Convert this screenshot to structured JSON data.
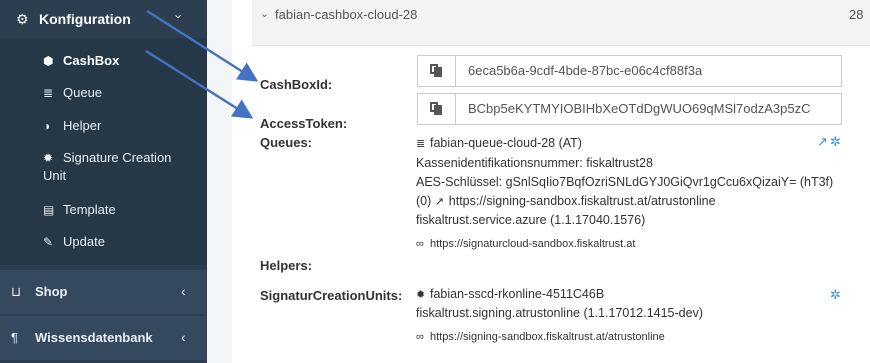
{
  "sidebar": {
    "config_label": "Konfiguration",
    "sub_items": [
      {
        "label": "CashBox",
        "icon": "cube-icon"
      },
      {
        "label": "Queue",
        "icon": "database-icon"
      },
      {
        "label": "Helper",
        "icon": "adjust-icon"
      },
      {
        "label": "Signature Creation",
        "icon": "certificate-icon"
      },
      {
        "label": "Unit",
        "icon": ""
      },
      {
        "label": "Template",
        "icon": "file-icon"
      },
      {
        "label": "Update",
        "icon": "wrench-icon"
      }
    ],
    "shop_label": "Shop",
    "wissen_label": "Wissensdatenbank"
  },
  "panel": {
    "title": "fabian-cashbox-cloud-28",
    "count": "28"
  },
  "fields": {
    "cashbox_label": "CashBoxId:",
    "cashbox_value": "6eca5b6a-9cdf-4bde-87bc-e06c4cf88f3a",
    "access_label": "AccessToken:",
    "access_value": "BCbp5eKYTMYIOBIHbXeOTdDgWUO69qMSl7odzA3p5zC"
  },
  "queues": {
    "label": "Queues:",
    "name": "fabian-queue-cloud-28 (AT)",
    "kassen": "Kassenidentifikationsnummer: fiskaltrust28",
    "aes": "AES-Schlüssel: gSnlSqIio7BqfOzriSNLdGYJ0GiQvr1gCcu6xQizaiY= (hT3f)",
    "endpoint": "https://signing-sandbox.fiskaltrust.at/atrustonline",
    "endpoint_prefix": "(0)",
    "service": "fiskaltrust.service.azure (1.1.17040.1576)",
    "link": "https://signaturcloud-sandbox.fiskaltrust.at"
  },
  "helpers": {
    "label": "Helpers:"
  },
  "scu": {
    "label": "SignaturCreationUnits:",
    "name": "fabian-sscd-rkonline-4511C46B",
    "package": "fiskaltrust.signing.atrustonline (1.1.17012.1415-dev)",
    "link": "https://signing-sandbox.fiskaltrust.at/atrustonline"
  },
  "colors": {
    "sidebar_bg": "#2c3e50",
    "sidebar_sub_bg": "#263748",
    "accent_blue": "#3a8fd0",
    "arrow_blue": "#4472c4"
  }
}
